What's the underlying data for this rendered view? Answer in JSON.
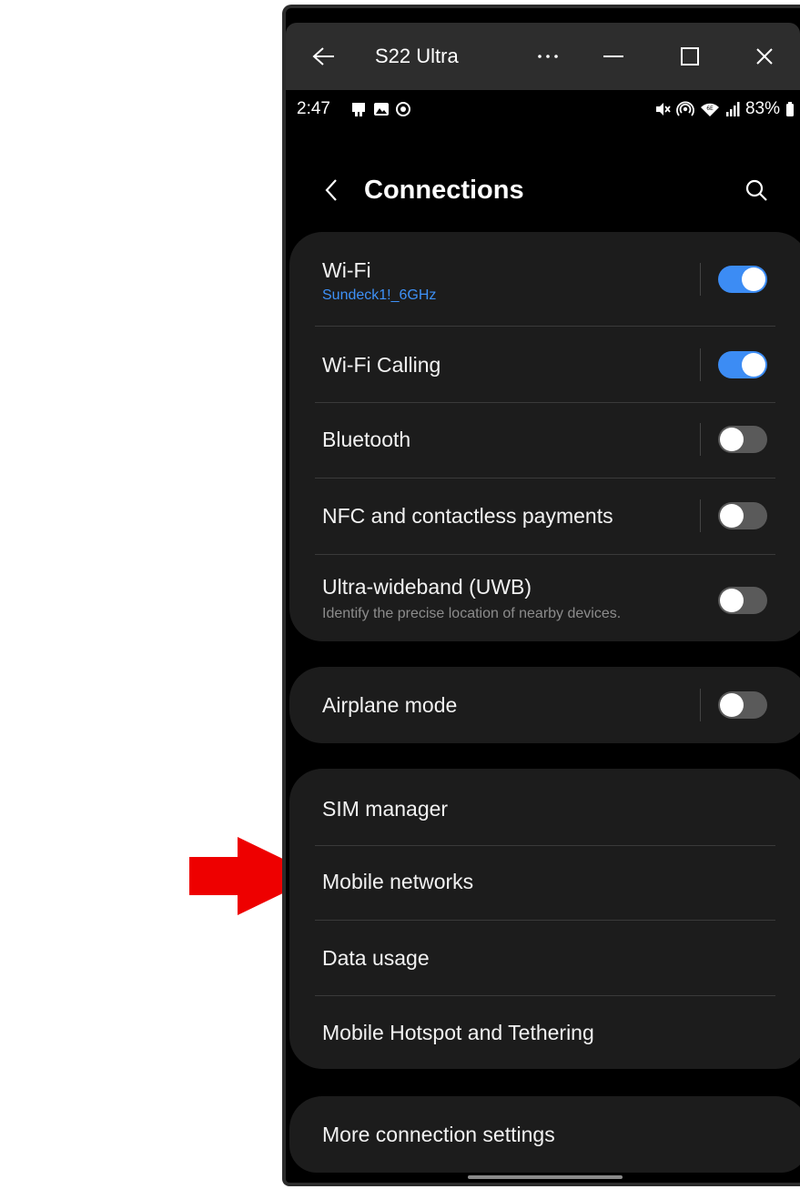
{
  "titlebar": {
    "title": "S22 Ultra"
  },
  "statusbar": {
    "time": "2:47",
    "battery": "83%",
    "left_icons": [
      "notification-app-icon",
      "gallery-icon",
      "screen-record-icon"
    ],
    "right_icons": [
      "mute-icon",
      "hotspot-icon",
      "wifi-6e-icon",
      "signal-icon",
      "battery-icon"
    ]
  },
  "header": {
    "title": "Connections"
  },
  "groups": [
    {
      "items": [
        {
          "label": "Wi-Fi",
          "sublabel": "Sundeck1!_6GHz",
          "toggle": true
        },
        {
          "label": "Wi-Fi Calling",
          "toggle": true
        },
        {
          "label": "Bluetooth",
          "toggle": false
        },
        {
          "label": "NFC and contactless payments",
          "toggle": false
        },
        {
          "label": "Ultra-wideband (UWB)",
          "sublabel": "Identify the precise location of nearby devices.",
          "toggle": false
        }
      ]
    },
    {
      "items": [
        {
          "label": "Airplane mode",
          "toggle": false
        }
      ]
    },
    {
      "items": [
        {
          "label": "SIM manager"
        },
        {
          "label": "Mobile networks"
        },
        {
          "label": "Data usage"
        },
        {
          "label": "Mobile Hotspot and Tethering"
        }
      ]
    },
    {
      "items": [
        {
          "label": "More connection settings"
        }
      ]
    }
  ],
  "annotation": {
    "arrow_color": "#ee0000",
    "points_to": "Mobile networks"
  },
  "colors": {
    "accent": "#3c8cf4",
    "background": "#000000",
    "card": "#1c1c1c",
    "sublabel_link": "#3e91f7"
  }
}
